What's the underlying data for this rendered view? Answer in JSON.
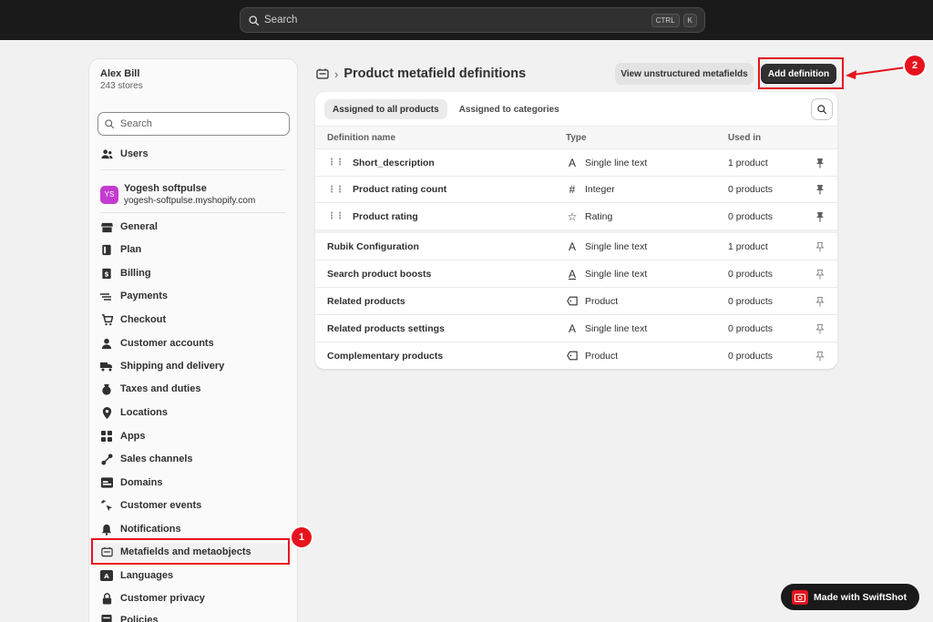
{
  "topbar": {
    "search_placeholder": "Search",
    "shortcut_1": "CTRL",
    "shortcut_2": "K"
  },
  "sidebar": {
    "account_name": "Alex Bill",
    "account_sub": "243 stores",
    "search_placeholder": "Search",
    "users_label": "Users",
    "store": {
      "initials": "YS",
      "name": "Yogesh softpulse",
      "domain": "yogesh-softpulse.myshopify.com"
    },
    "items": [
      {
        "label": "General",
        "icon": "store-icon"
      },
      {
        "label": "Plan",
        "icon": "plan-icon"
      },
      {
        "label": "Billing",
        "icon": "billing-icon"
      },
      {
        "label": "Payments",
        "icon": "payments-icon"
      },
      {
        "label": "Checkout",
        "icon": "cart-icon"
      },
      {
        "label": "Customer accounts",
        "icon": "person-icon"
      },
      {
        "label": "Shipping and delivery",
        "icon": "truck-icon"
      },
      {
        "label": "Taxes and duties",
        "icon": "tax-icon"
      },
      {
        "label": "Locations",
        "icon": "location-icon"
      },
      {
        "label": "Apps",
        "icon": "apps-icon"
      },
      {
        "label": "Sales channels",
        "icon": "channels-icon"
      },
      {
        "label": "Domains",
        "icon": "domains-icon"
      },
      {
        "label": "Customer events",
        "icon": "cursor-icon"
      },
      {
        "label": "Notifications",
        "icon": "bell-icon"
      },
      {
        "label": "Metafields and metaobjects",
        "icon": "metafields-icon"
      },
      {
        "label": "Languages",
        "icon": "languages-icon"
      },
      {
        "label": "Customer privacy",
        "icon": "lock-icon"
      },
      {
        "label": "Policies",
        "icon": "policies-icon"
      }
    ]
  },
  "header": {
    "title": "Product metafield definitions",
    "view_unstructured": "View unstructured metafields",
    "add_definition": "Add definition"
  },
  "tabs": [
    "Assigned to all products",
    "Assigned to categories"
  ],
  "table": {
    "columns": [
      "Definition name",
      "Type",
      "Used in"
    ],
    "pinned_rows": [
      {
        "name": "Short_description",
        "type": "Single line text",
        "type_icon": "A",
        "used": "1 product"
      },
      {
        "name": "Product rating count",
        "type": "Integer",
        "type_icon": "#",
        "used": "0 products"
      },
      {
        "name": "Product rating",
        "type": "Rating",
        "type_icon": "☆",
        "used": "0 products"
      }
    ],
    "rows": [
      {
        "name": "Rubik Configuration",
        "type": "Single line text",
        "type_icon": "A",
        "used": "1 product"
      },
      {
        "name": "Search product boosts",
        "type": "Single line text",
        "type_icon": "A",
        "used": "0 products"
      },
      {
        "name": "Related products",
        "type": "Product",
        "type_icon": "tag",
        "used": "0 products"
      },
      {
        "name": "Related products settings",
        "type": "Single line text",
        "type_icon": "A",
        "used": "0 products"
      },
      {
        "name": "Complementary products",
        "type": "Product",
        "type_icon": "tag",
        "used": "0 products"
      }
    ]
  },
  "annotations": {
    "step1": "1",
    "step2": "2"
  },
  "badge": {
    "label": "Made with SwiftShot"
  },
  "colors": {
    "accent_red": "#e5131d",
    "primary_button": "#303030",
    "topbar": "#1a1a1a"
  }
}
